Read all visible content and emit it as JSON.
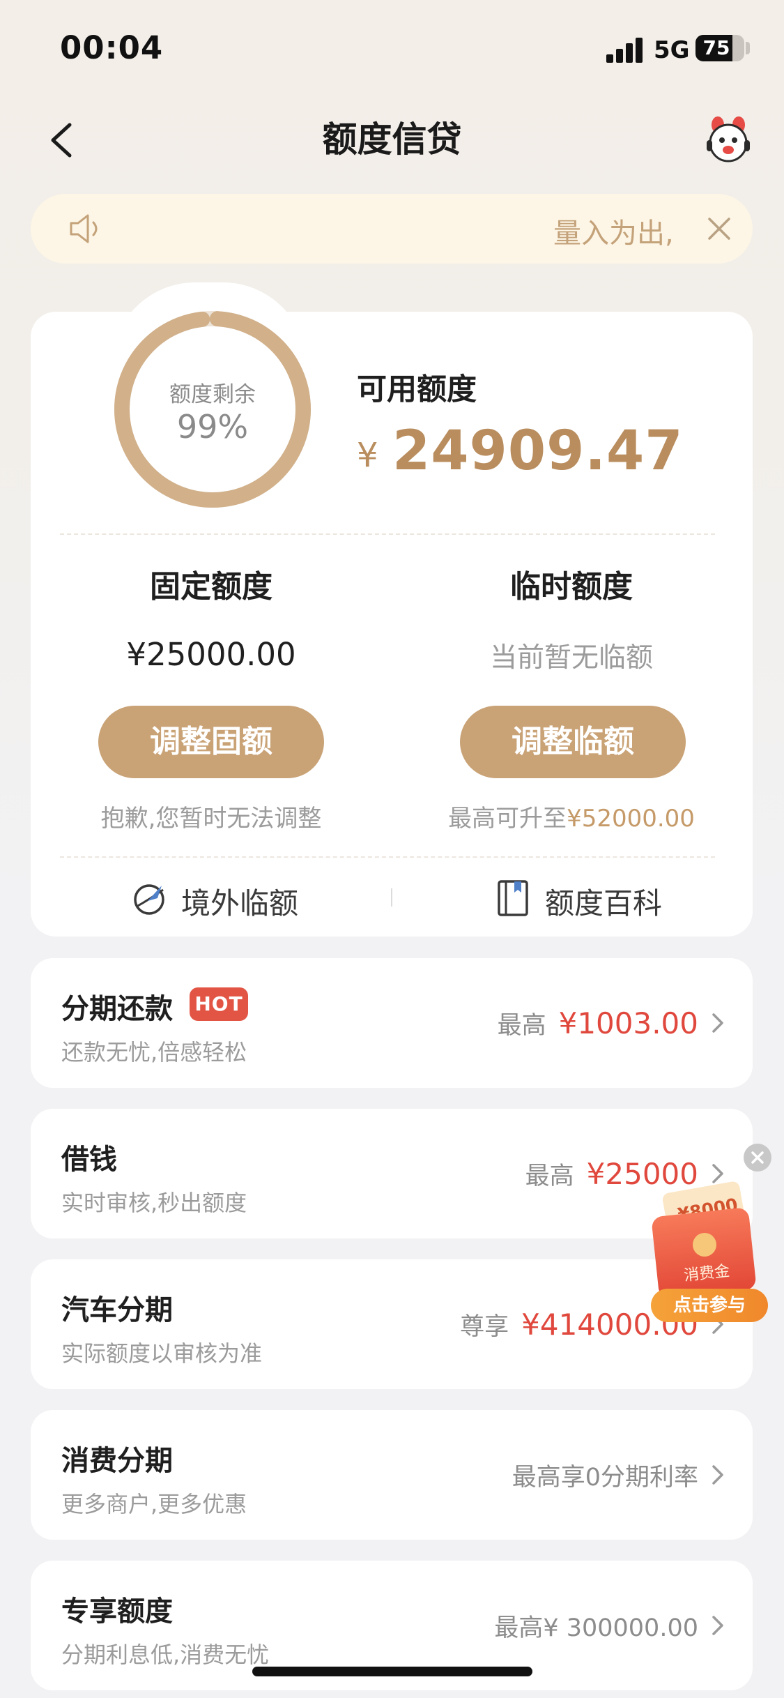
{
  "status_bar": {
    "time": "00:04",
    "network": "5G",
    "battery": "75",
    "battery_level_percent": 75
  },
  "nav": {
    "title": "额度信贷",
    "back_icon": "chevron-left-icon",
    "service_icon": "mascot-service-icon"
  },
  "notice": {
    "text": "量入为出,",
    "icon": "speaker-icon",
    "close_icon": "close-icon"
  },
  "credit": {
    "ring_label": "额度剩余",
    "ring_value": "99%",
    "ring_percent": 99,
    "available_label": "可用额度",
    "currency": "¥",
    "available_amount": "24909.47",
    "fixed": {
      "title": "固定额度",
      "value": "¥25000.00",
      "button": "调整固额",
      "note": "抱歉,您暂时无法调整"
    },
    "temporary": {
      "title": "临时额度",
      "status": "当前暂无临额",
      "button": "调整临额",
      "note_prefix": "最高可升至",
      "note_amount": "¥52000.00"
    },
    "links": [
      {
        "label": "境外临额",
        "icon": "globe-plane-icon"
      },
      {
        "label": "额度百科",
        "icon": "book-icon"
      }
    ]
  },
  "products": [
    {
      "title": "分期还款",
      "badge": "HOT",
      "subtitle": "还款无忧,倍感轻松",
      "prefix": "最高",
      "amount": "¥1003.00"
    },
    {
      "title": "借钱",
      "subtitle": "实时审核,秒出额度",
      "prefix": "最高",
      "amount": "¥25000"
    },
    {
      "title": "汽车分期",
      "subtitle": "实际额度以审核为准",
      "prefix": "尊享",
      "amount": "¥414000.00"
    },
    {
      "title": "消费分期",
      "subtitle": "更多商户,更多优惠",
      "plain": "最高享0分期利率"
    },
    {
      "title": "专享额度",
      "subtitle": "分期利息低,消费无忧",
      "plain": "最高¥ 300000.00"
    }
  ],
  "promo": {
    "amount": "¥8000",
    "label": "消费金",
    "button": "点击参与",
    "close_icon": "close-icon"
  },
  "colors": {
    "gold": "#c9a276",
    "gold_text": "#b98d5e",
    "red": "#e0483d",
    "notice_bg": "#fdf6e6",
    "hot_badge": "#e25545"
  }
}
